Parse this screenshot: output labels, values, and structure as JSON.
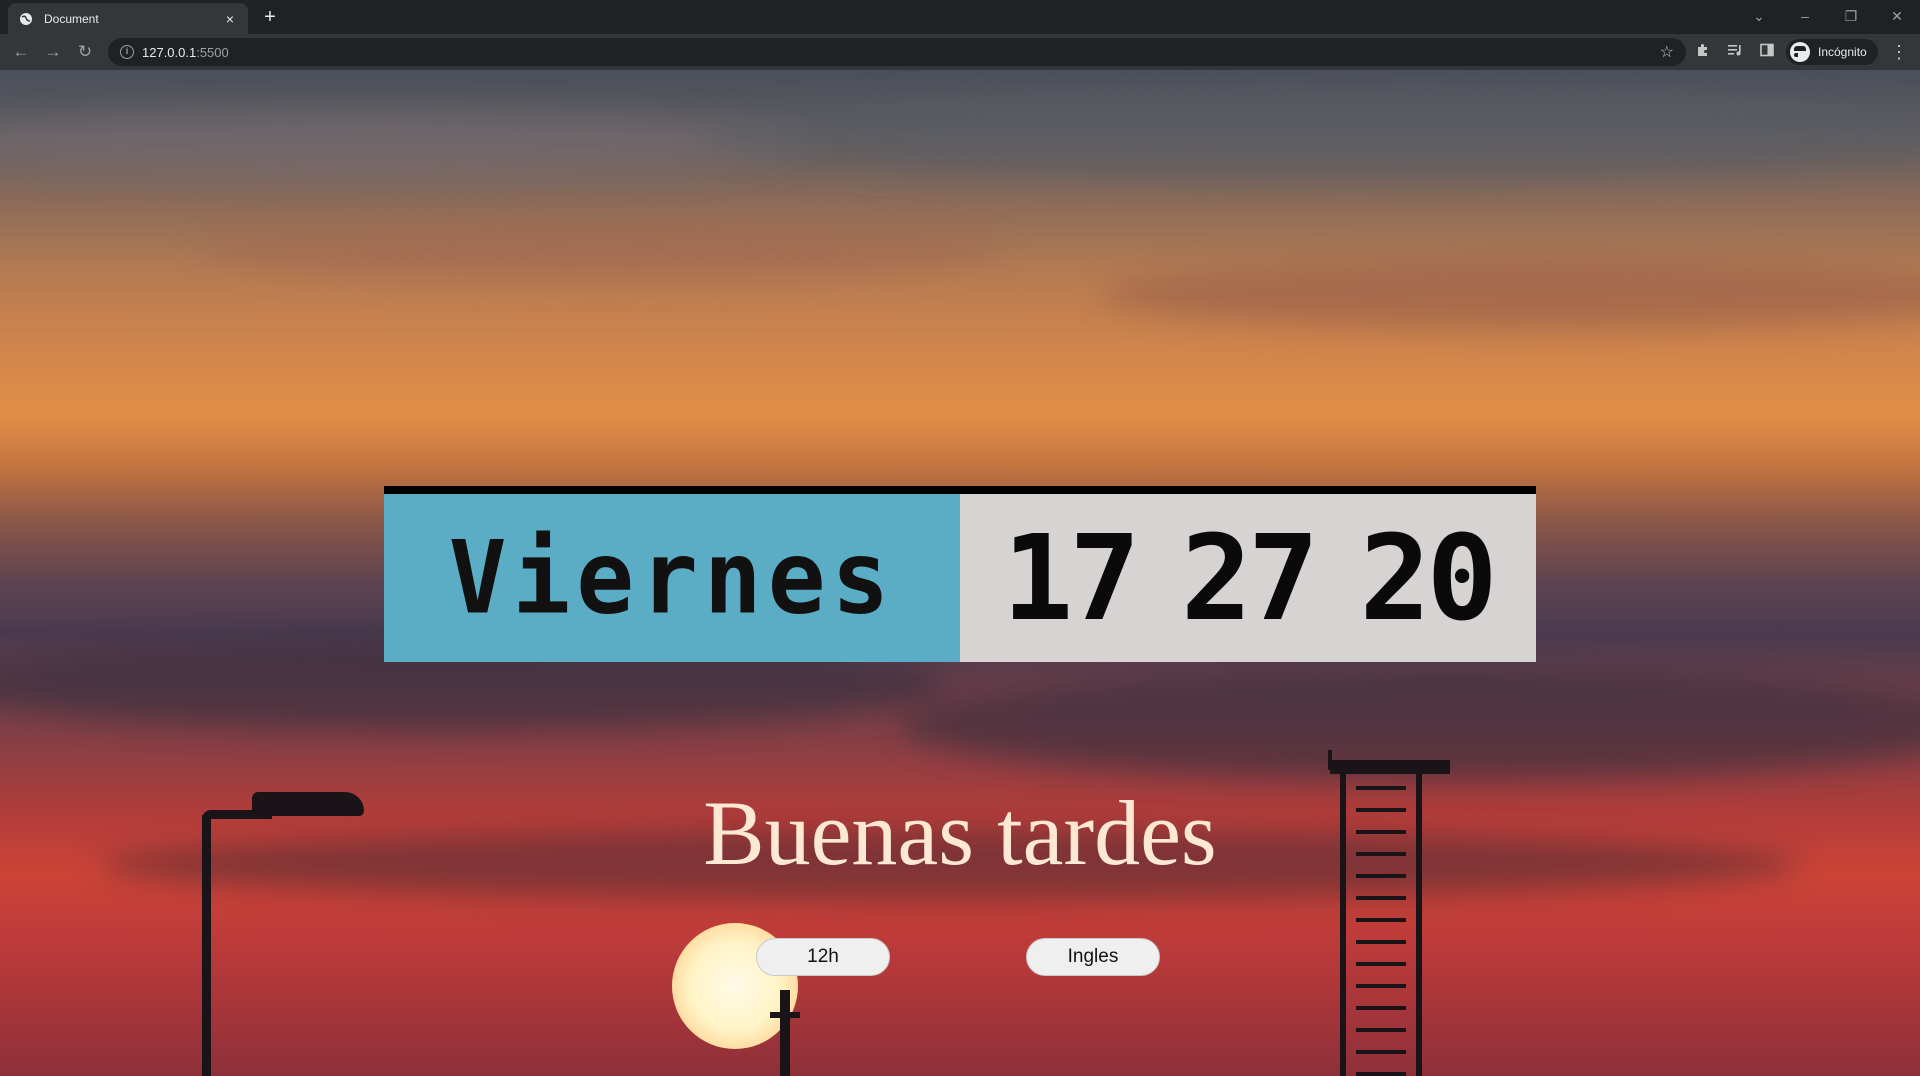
{
  "browser": {
    "tab": {
      "title": "Document",
      "favicon": "globe-icon",
      "close": "×"
    },
    "new_tab": "+",
    "window_controls": {
      "minimize": "–",
      "restore": "❐",
      "close": "✕",
      "tab_search": "⌄"
    },
    "nav": {
      "back": "←",
      "forward": "→",
      "reload": "↻"
    },
    "address": {
      "host": "127.0.0.1",
      "port": ":5500"
    },
    "icons": {
      "star": "☆",
      "extensions": "puzzle-icon",
      "media": "media-list-icon",
      "side_panel": "side-panel-icon",
      "menu": "⋮"
    },
    "profile": {
      "label": "Incógnito"
    }
  },
  "page": {
    "clock": {
      "day": "Viernes",
      "hours": "17",
      "minutes": "27",
      "seconds": "20"
    },
    "greeting": "Buenas tardes",
    "buttons": {
      "format": "12h",
      "language": "Ingles"
    }
  },
  "colors": {
    "day_panel": "#5badc6",
    "time_panel": "#d7d3d3",
    "greeting": "#fde8d4",
    "clock_border": "#000000"
  }
}
